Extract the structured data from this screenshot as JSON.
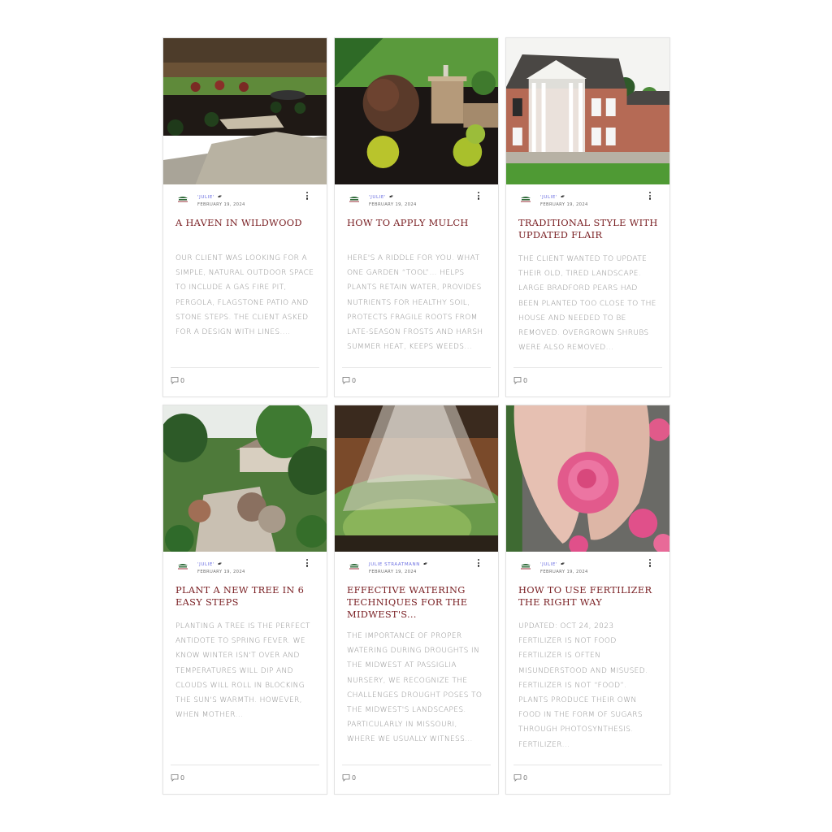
{
  "posts": [
    {
      "image": "fire-pit-flagstone-patio-photo",
      "author": "'JULIE'",
      "date": "FEBRUARY 19, 2024",
      "title": "A HAVEN IN WILDWOOD",
      "excerpt": "OUR CLIENT WAS LOOKING FOR A SIMPLE, NATURAL OUTDOOR SPACE TO INCLUDE A GAS FIRE PIT, PERGOLA, FLAGSTONE PATIO AND STONE STEPS. THE CLIENT ASKED FOR A DESIGN WITH LINES....",
      "comments": "0"
    },
    {
      "image": "mulch-garden-bed-photo",
      "author": "'JULIE'",
      "date": "FEBRUARY 19, 2024",
      "title": "HOW TO APPLY MULCH",
      "excerpt": "HERE'S A RIDDLE FOR YOU. WHAT ONE GARDEN “TOOL”… HELPS PLANTS RETAIN WATER, PROVIDES NUTRIENTS FOR HEALTHY SOIL, PROTECTS FRAGILE ROOTS FROM LATE-SEASON FROSTS AND HARSH SUMMER HEAT, KEEPS WEEDS...",
      "comments": "0"
    },
    {
      "image": "brick-colonial-house-photo",
      "author": "'JULIE'",
      "date": "FEBRUARY 19, 2024",
      "title": "TRADITIONAL STYLE WITH UPDATED FLAIR",
      "excerpt": "THE CLIENT WANTED TO UPDATE THEIR OLD, TIRED LANDSCAPE. LARGE BRADFORD PEARS HAD BEEN PLANTED TOO CLOSE TO THE HOUSE AND NEEDED TO BE REMOVED. OVERGROWN SHRUBS WERE ALSO REMOVED...",
      "comments": "0"
    },
    {
      "image": "river-rock-garden-path-photo",
      "author": "'JULIE'",
      "date": "FEBRUARY 19, 2024",
      "title": "PLANT A NEW TREE IN 6 EASY STEPS",
      "excerpt": "PLANTING A TREE IS THE PERFECT ANTIDOTE TO SPRING FEVER. WE KNOW WINTER ISN'T OVER AND TEMPERATURES WILL DIP AND CLOUDS WILL ROLL IN BLOCKING THE SUN'S WARMTH.  HOWEVER, WHEN MOTHER...",
      "comments": "0"
    },
    {
      "image": "watering-plants-photo",
      "author": "JULIE STRAATMANN",
      "date": "FEBRUARY 19, 2024",
      "title": "EFFECTIVE WATERING TECHNIQUES FOR THE MIDWEST'S...",
      "excerpt": "THE IMPORTANCE OF PROPER WATERING DURING DROUGHTS IN THE MIDWEST AT PASSIGLIA NURSERY, WE RECOGNIZE THE CHALLENGES DROUGHT POSES TO THE MIDWEST'S LANDSCAPES. PARTICULARLY IN MISSOURI, WHERE WE USUALLY WITNESS...",
      "comments": "0"
    },
    {
      "image": "hands-holding-pink-flower-photo",
      "author": "'JULIE'",
      "date": "FEBRUARY 19, 2024",
      "title": "HOW TO USE FERTILIZER THE RIGHT WAY",
      "excerpt": "UPDATED: OCT 24, 2023 FERTILIZER IS NOT FOOD FERTILIZER IS OFTEN MISUNDERSTOOD AND MISUSED. FERTILIZER IS NOT “FOOD”.  PLANTS PRODUCE THEIR OWN FOOD IN THE FORM OF SUGARS THROUGH PHOTOSYNTHESIS. FERTILIZER...",
      "comments": "0"
    }
  ],
  "colors": {
    "title": "#7a2024",
    "author": "#6a6ee0",
    "excerpt": "#8a8a8a"
  }
}
